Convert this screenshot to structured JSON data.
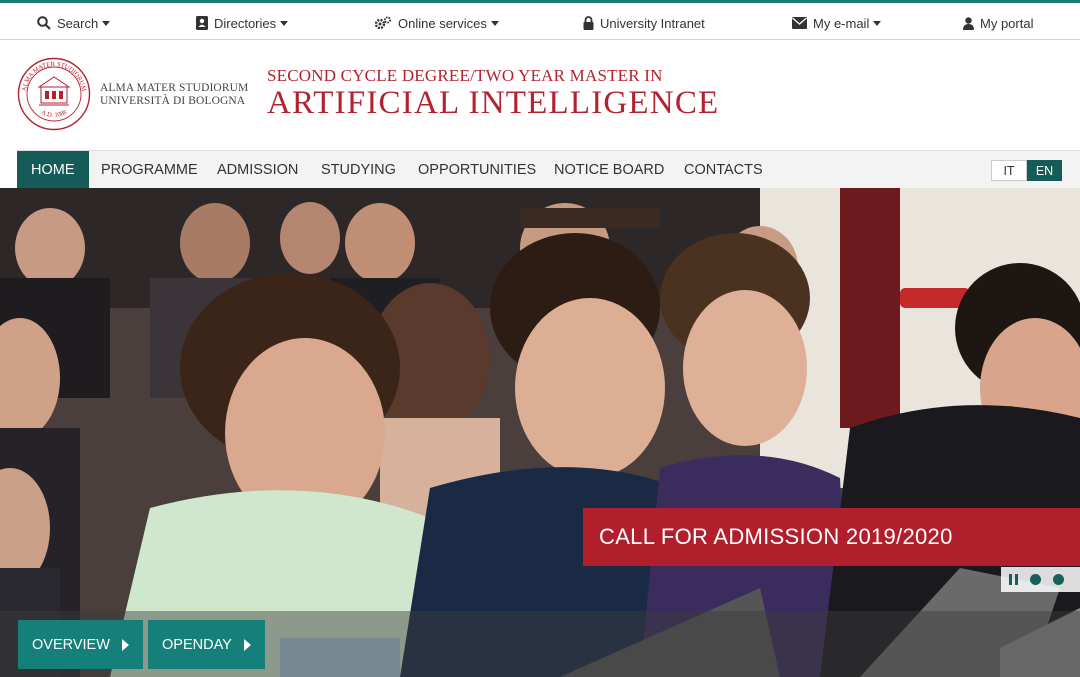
{
  "topbar": {
    "items": [
      {
        "label": "Search",
        "icon": "search-icon",
        "dropdown": true
      },
      {
        "label": "Directories",
        "icon": "address-book-icon",
        "dropdown": true
      },
      {
        "label": "Online services",
        "icon": "gears-icon",
        "dropdown": true
      },
      {
        "label": "University Intranet",
        "icon": "lock-icon",
        "dropdown": false
      },
      {
        "label": "My e-mail",
        "icon": "envelope-icon",
        "dropdown": true
      },
      {
        "label": "My portal",
        "icon": "user-icon",
        "dropdown": false
      }
    ]
  },
  "header": {
    "university_line1": "ALMA MATER STUDIORUM",
    "university_line2": "UNIVERSITÀ DI BOLOGNA",
    "seal_text_top": "ALMA MATER STUDIORUM",
    "seal_text_bottom": "A.D. 1088",
    "programme_subtitle": "SECOND CYCLE DEGREE/TWO YEAR MASTER IN",
    "programme_title": "ARTIFICIAL INTELLIGENCE"
  },
  "nav": {
    "items": [
      "HOME",
      "PROGRAMME",
      "ADMISSION",
      "STUDYING",
      "OPPORTUNITIES",
      "NOTICE BOARD",
      "CONTACTS"
    ],
    "active": "HOME",
    "lang_it": "IT",
    "lang_en": "EN",
    "lang_active": "EN"
  },
  "hero": {
    "banner": "CALL FOR ADMISSION 2019/2020",
    "cta_overview": "OVERVIEW",
    "cta_openday": "OPENDAY"
  },
  "colors": {
    "teal": "#155b57",
    "teal_button": "#15807a",
    "brand_red": "#b3232f",
    "banner_red": "#b01f2b"
  }
}
